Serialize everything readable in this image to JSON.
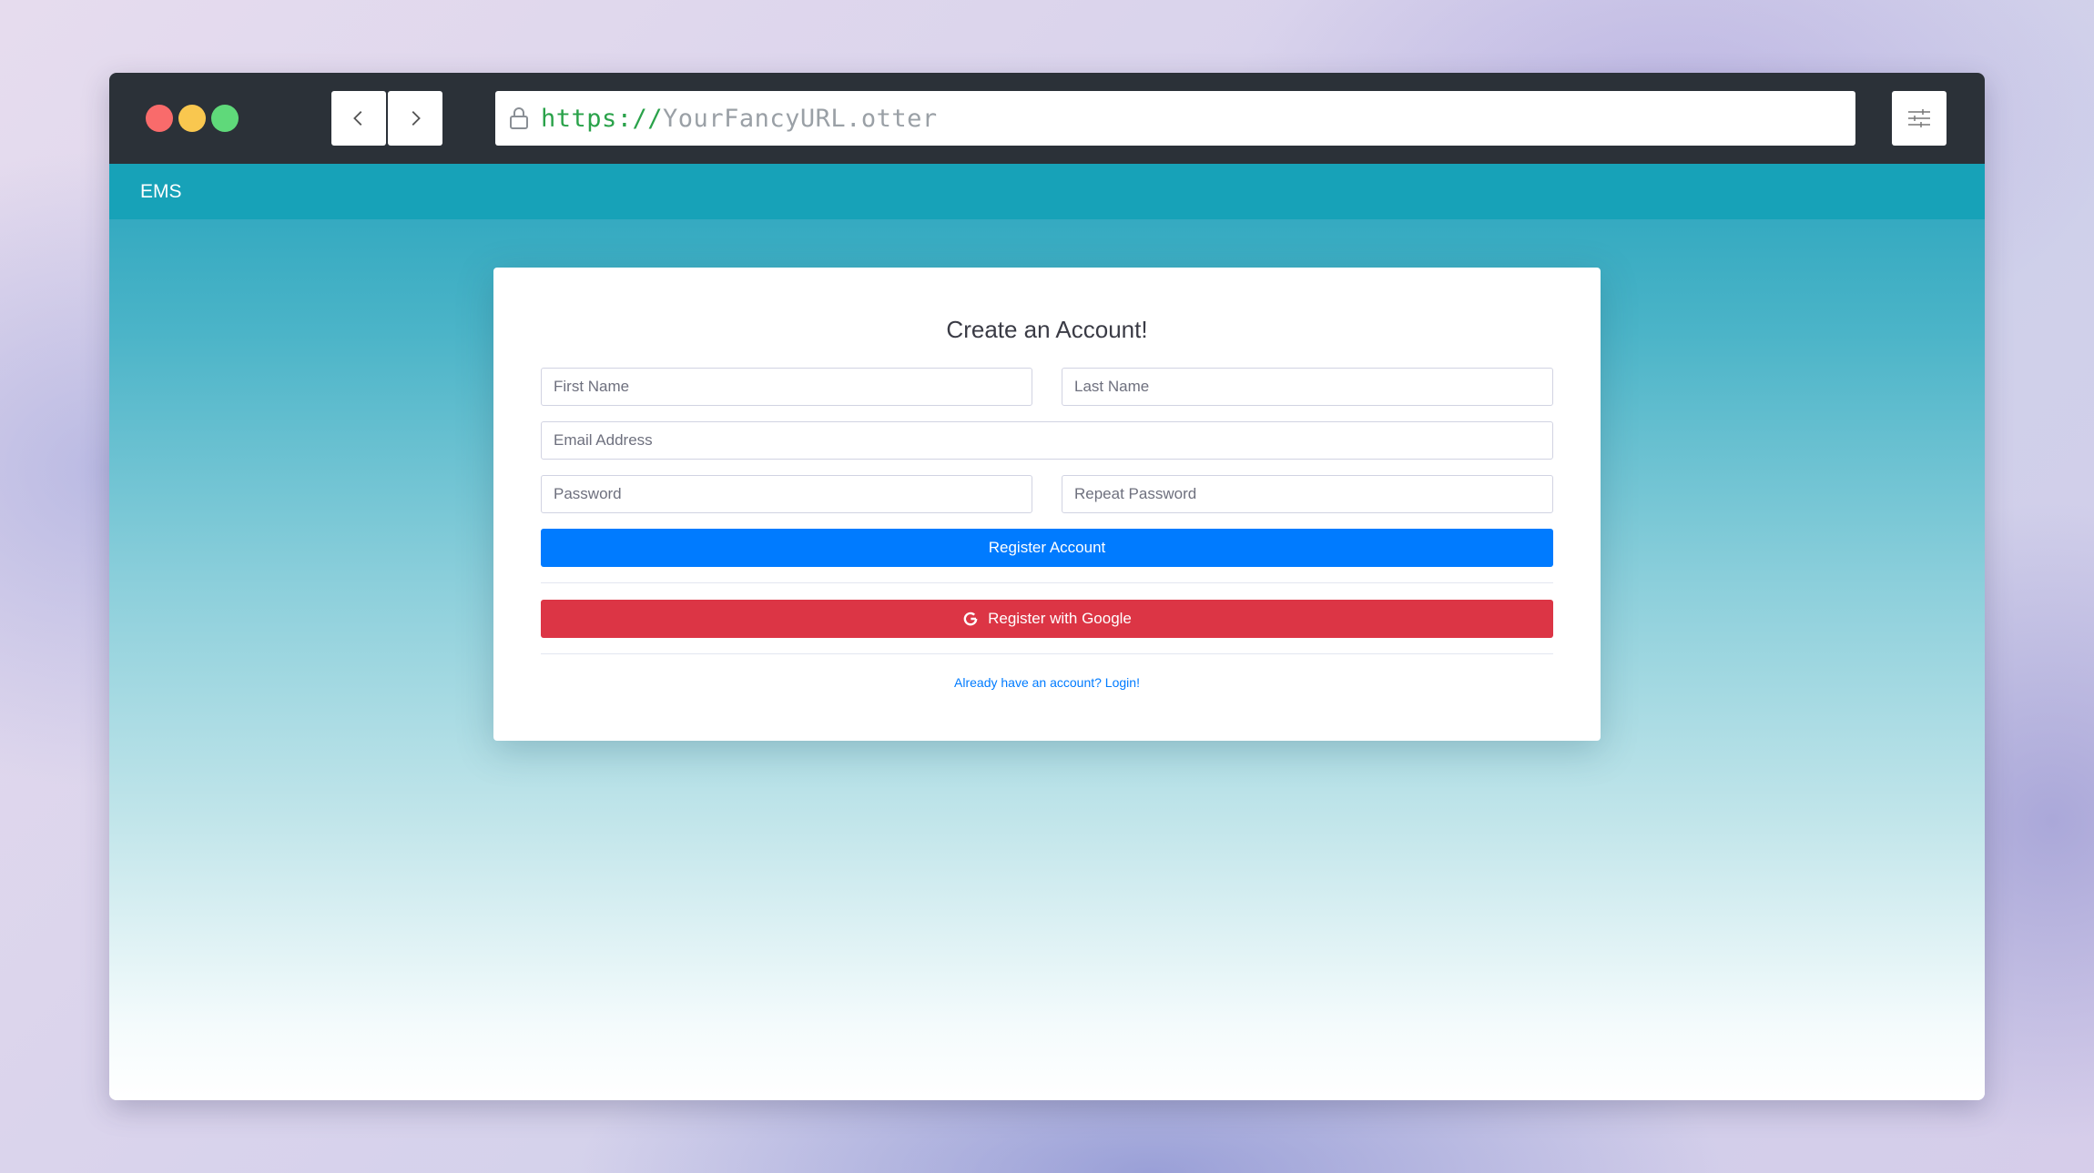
{
  "browser": {
    "url_scheme": "https://",
    "url_host": "YourFancyURL.otter"
  },
  "navbar": {
    "brand": "EMS"
  },
  "form": {
    "title": "Create an Account!",
    "first_name_placeholder": "First Name",
    "last_name_placeholder": "Last Name",
    "email_placeholder": "Email Address",
    "password_placeholder": "Password",
    "repeat_password_placeholder": "Repeat Password",
    "register_label": "Register Account",
    "google_label": "Register with Google",
    "login_link": "Already have an account? Login!"
  },
  "colors": {
    "navbar": "#17a2b8",
    "primary_button": "#007bff",
    "google_button": "#dc3545",
    "titlebar": "#2b3138"
  },
  "icons": {
    "back": "chevron-left-icon",
    "forward": "chevron-right-icon",
    "lock": "lock-icon",
    "settings": "sliders-icon",
    "google": "google-g-icon"
  }
}
